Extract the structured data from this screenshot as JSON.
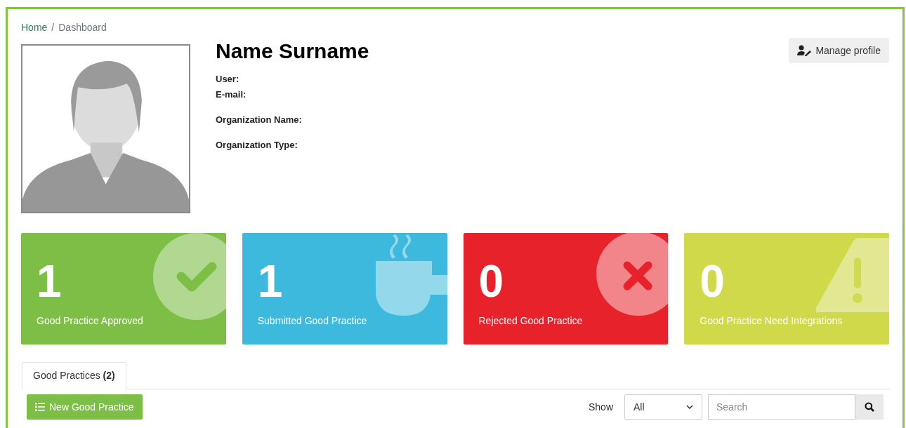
{
  "breadcrumb": {
    "separator": "/",
    "items": [
      {
        "label": "Home",
        "link": true
      },
      {
        "label": "Dashboard",
        "link": false
      }
    ]
  },
  "profile": {
    "name": "Name Surname",
    "fields": [
      "User:",
      "E-mail:",
      "Organization Name:",
      "Organization Type:"
    ],
    "manage_button": "Manage profile"
  },
  "cards": [
    {
      "kind": "check",
      "count": "1",
      "label": "Good Practice Approved",
      "color": "#7dbf46"
    },
    {
      "kind": "cup",
      "count": "1",
      "label": "Submitted Good Practice",
      "color": "#3cb9dc"
    },
    {
      "kind": "cross",
      "count": "0",
      "label": "Rejected Good Practice",
      "color": "#e8222a"
    },
    {
      "kind": "warning",
      "count": "0",
      "label": "Good Practice Need Integrations",
      "color": "#cfd94a"
    }
  ],
  "tabs": [
    {
      "label": "Good Practices **(2)**",
      "selected": true
    }
  ],
  "toolbar": {
    "new_button": "New Good Practice",
    "show_label": "Show",
    "show_value": "All",
    "search_placeholder": "Search"
  }
}
